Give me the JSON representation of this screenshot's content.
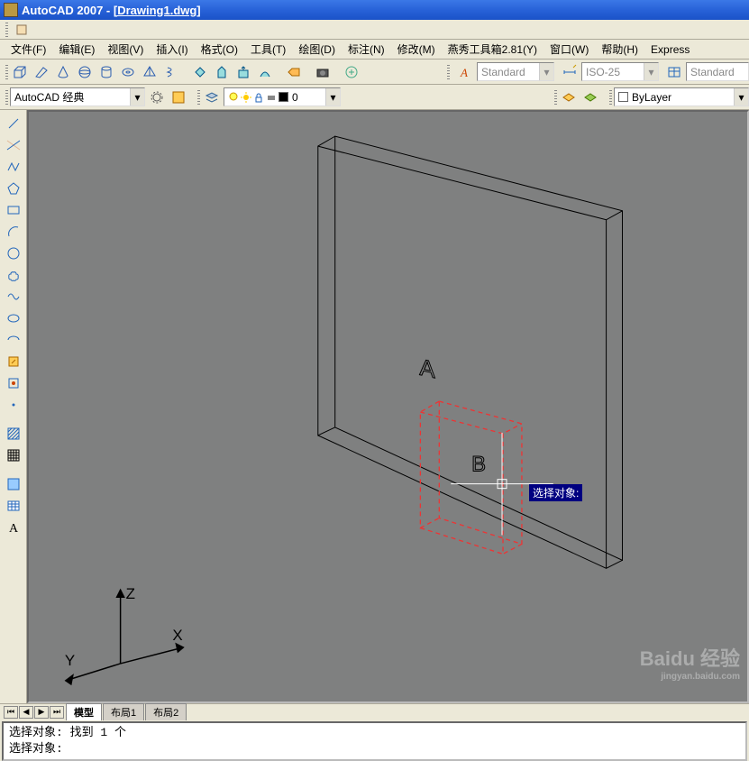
{
  "title": {
    "app": "AutoCAD 2007 - ",
    "doc": "[Drawing1.dwg]"
  },
  "menu": [
    "文件(F)",
    "编辑(E)",
    "视图(V)",
    "插入(I)",
    "格式(O)",
    "工具(T)",
    "绘图(D)",
    "标注(N)",
    "修改(M)",
    "燕秀工具箱2.81(Y)",
    "窗口(W)",
    "帮助(H)",
    "Express"
  ],
  "row2": {
    "text_style": "Standard",
    "dim_style": "ISO-25",
    "table_style": "Standard"
  },
  "row3": {
    "workspace": "AutoCAD 经典",
    "layer_value": "0",
    "prop_layer": "ByLayer"
  },
  "tabs": {
    "model": "模型",
    "layout1": "布局1",
    "layout2": "布局2"
  },
  "canvas": {
    "labelA": "A",
    "labelB": "B",
    "ucs": {
      "x": "X",
      "y": "Y",
      "z": "Z"
    }
  },
  "tooltip": "选择对象:",
  "cmd": {
    "line1": "选择对象: 找到 1 个",
    "line2": "选择对象:"
  },
  "watermark": {
    "main": "Baidu 经验",
    "sub": "jingyan.baidu.com"
  },
  "icons": {
    "row1": [
      "box",
      "box",
      "box",
      "box",
      "box",
      "box",
      "box",
      "box",
      "sep",
      "sphere",
      "sphere",
      "sphere",
      "sphere",
      "sep",
      "cube3d",
      "sep",
      "camera",
      "sep",
      "plus-circle"
    ],
    "row3_tools": [
      "gear",
      "sun"
    ],
    "row3_layer": [
      "layers",
      "bulb",
      "sun-small",
      "lock",
      "square",
      "printer"
    ],
    "row3_color": [
      "palette",
      "palette"
    ],
    "vtools": [
      "line",
      "arc",
      "polyline",
      "polygon",
      "rect",
      "arc2",
      "circle",
      "spline",
      "cloud",
      "wave",
      "ellipse",
      "ellipse-arc",
      "point",
      "point2",
      "sep",
      "hatch",
      "region",
      "sep",
      "table",
      "text"
    ]
  }
}
